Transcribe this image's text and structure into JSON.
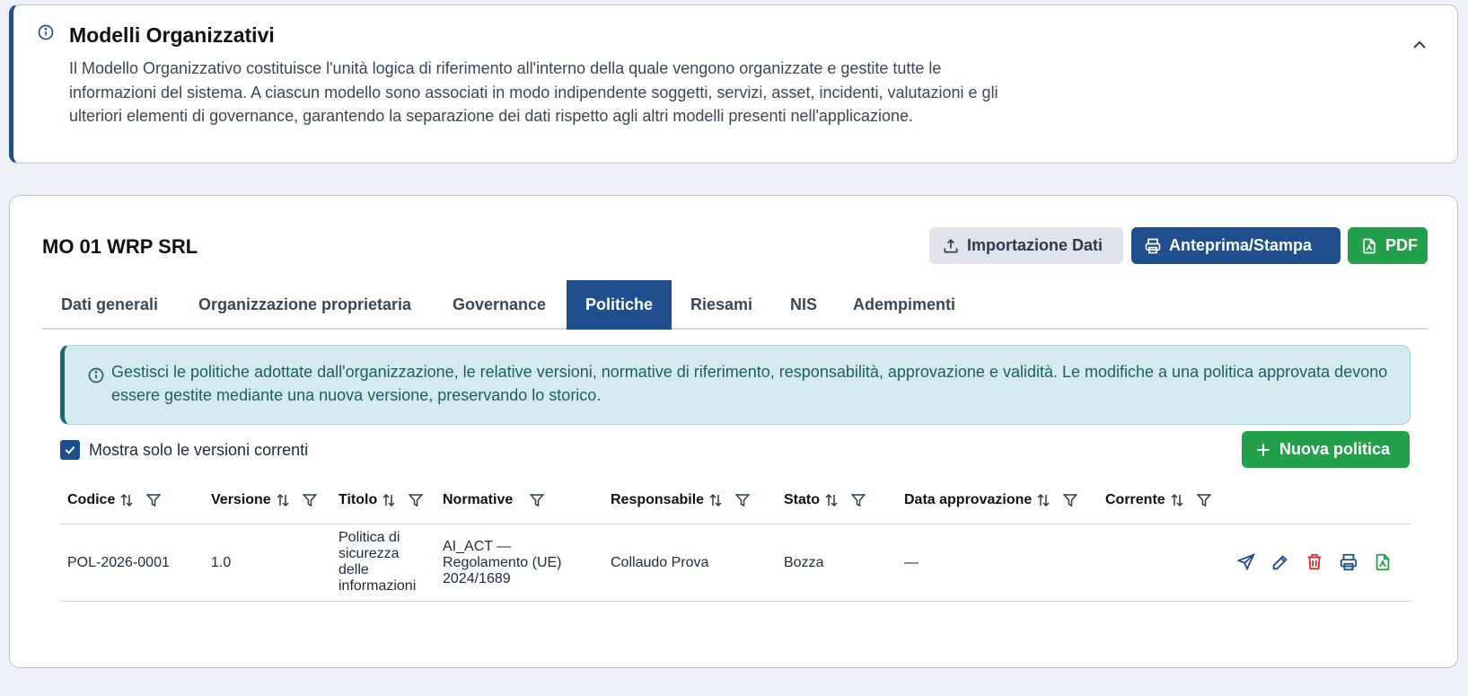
{
  "info_card": {
    "title": "Modelli Organizzativi",
    "description": "Il Modello Organizzativo costituisce l'unità logica di riferimento all'interno della quale vengono organizzate e gestite tutte le informazioni del sistema. A ciascun modello sono associati in modo indipendente soggetti, servizi, asset, incidenti, valutazioni e gli ulteriori elementi di governance, garantendo la separazione dei dati rispetto agli altri modelli presenti nell'applicazione."
  },
  "model": {
    "title": "MO 01 WRP SRL",
    "import_label": "Importazione Dati",
    "print_label": "Anteprima/Stampa",
    "pdf_label": "PDF"
  },
  "tabs": [
    {
      "label": "Dati generali"
    },
    {
      "label": "Organizzazione proprietaria"
    },
    {
      "label": "Governance"
    },
    {
      "label": "Politiche"
    },
    {
      "label": "Riesami"
    },
    {
      "label": "NIS"
    },
    {
      "label": "Adempimenti"
    }
  ],
  "active_tab": "Politiche",
  "alert": {
    "text": "Gestisci le politiche adottate dall'organizzazione, le relative versioni, normative di riferimento, responsabilità, approvazione e validità. Le modifiche a una politica approvata devono essere gestite mediante una nuova versione, preservando lo storico."
  },
  "filter": {
    "show_current_label": "Mostra solo le versioni correnti",
    "show_current_checked": true
  },
  "new_policy_label": "Nuova politica",
  "table": {
    "columns": [
      {
        "label": "Codice"
      },
      {
        "label": "Versione"
      },
      {
        "label": "Titolo"
      },
      {
        "label": "Normative"
      },
      {
        "label": "Responsabile"
      },
      {
        "label": "Stato"
      },
      {
        "label": "Data approvazione"
      },
      {
        "label": "Corrente"
      }
    ],
    "rows": [
      {
        "codice": "POL-2026-0001",
        "versione": "1.0",
        "titolo": "Politica di sicurezza delle informazioni",
        "normative": "AI_ACT — Regolamento (UE) 2024/1689",
        "responsabile": "Collaudo Prova",
        "stato": "Bozza",
        "data_approvazione": "—",
        "corrente": ""
      }
    ]
  },
  "colors": {
    "primary": "#1f4e8c",
    "success": "#22a04a",
    "danger": "#d32f2f",
    "alert_bg": "#d3ebee",
    "alert_text": "#1d5d66"
  },
  "icons": {
    "info": "info-icon",
    "collapse": "chevron-up-icon",
    "import": "upload-icon",
    "print": "printer-icon",
    "pdf": "file-pdf-icon",
    "checkbox": "check-icon",
    "new": "plus-icon",
    "sort": "sort-icon",
    "filter": "filter-icon",
    "row_actions": [
      "send-icon",
      "edit-icon",
      "trash-icon",
      "printer-icon",
      "file-pdf-icon"
    ]
  }
}
